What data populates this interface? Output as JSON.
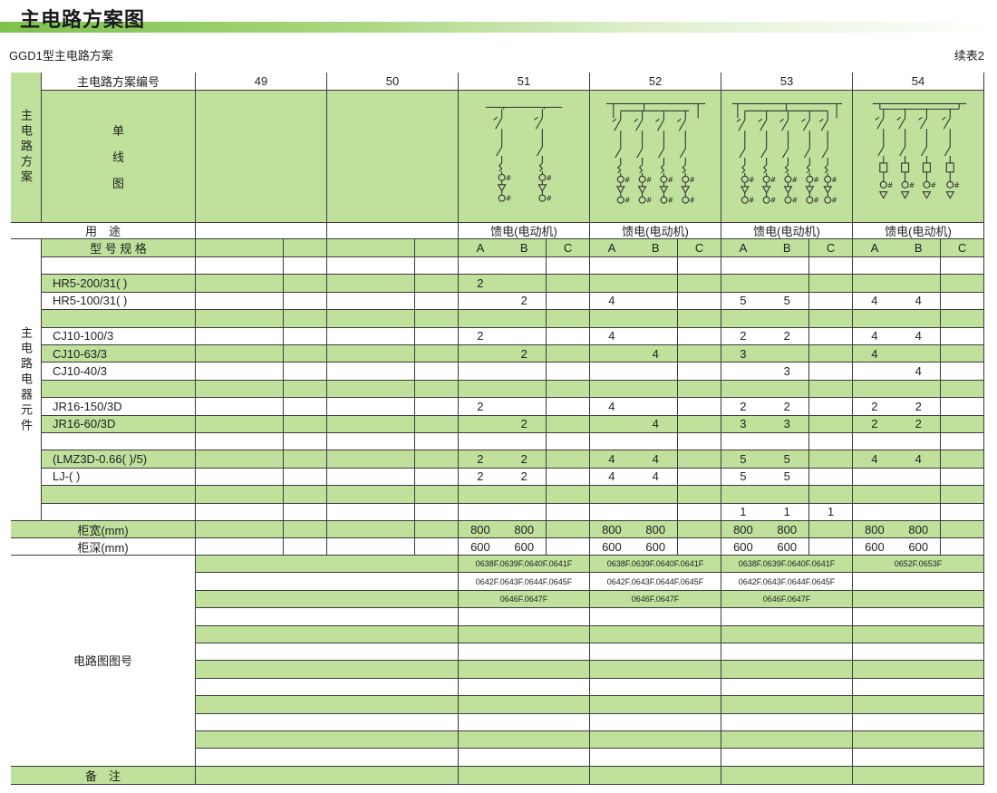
{
  "page": {
    "title": "主电路方案图",
    "subtitle": "GGD1型主电路方案",
    "continued": "续表2"
  },
  "table": {
    "header_scheme_number": "主电路方案编号",
    "left_label_scheme": "主电路方案",
    "single_line_label": [
      "单",
      "线",
      "图"
    ],
    "usage_label": "用　途",
    "model_label": "型 号 规 格",
    "left_label_components": "主电路电器元件",
    "width_label": "柜宽(mm)",
    "depth_label": "柜深(mm)",
    "circuit_no_label": "电路图图号",
    "remarks_label": "备　注",
    "schemes": [
      {
        "no": "49",
        "usage": "",
        "diagram": "none"
      },
      {
        "no": "50",
        "usage": "",
        "diagram": "none"
      },
      {
        "no": "51",
        "usage": "馈电(电动机)",
        "diagram": "two-branch"
      },
      {
        "no": "52",
        "usage": "馈电(电动机)",
        "diagram": "four-branch"
      },
      {
        "no": "53",
        "usage": "馈电(电动机)",
        "diagram": "five-branch"
      },
      {
        "no": "54",
        "usage": "馈电(电动机)",
        "diagram": "four-branch-alt"
      }
    ],
    "sub_columns": [
      "A",
      "B",
      "C"
    ],
    "components": [
      {
        "name": "",
        "values": [
          "",
          "",
          "",
          "",
          "",
          "",
          "",
          "",
          "",
          "",
          "",
          "",
          "",
          "",
          "",
          "",
          "",
          ""
        ]
      },
      {
        "name": "HR5-200/31(  )",
        "values": [
          "",
          "",
          "",
          "",
          "",
          "",
          "2",
          "",
          "",
          "",
          "",
          "",
          "",
          "",
          "",
          "",
          "",
          ""
        ]
      },
      {
        "name": "HR5-100/31(  )",
        "values": [
          "",
          "",
          "",
          "",
          "",
          "",
          "",
          "2",
          "",
          "4",
          "",
          "",
          "5",
          "5",
          "",
          "4",
          "4",
          ""
        ]
      },
      {
        "name": "",
        "values": [
          "",
          "",
          "",
          "",
          "",
          "",
          "",
          "",
          "",
          "",
          "",
          "",
          "",
          "",
          "",
          "",
          "",
          ""
        ]
      },
      {
        "name": "CJ10-100/3",
        "values": [
          "",
          "",
          "",
          "",
          "",
          "",
          "2",
          "",
          "",
          "4",
          "",
          "",
          "2",
          "2",
          "",
          "4",
          "4",
          ""
        ]
      },
      {
        "name": "CJ10-63/3",
        "values": [
          "",
          "",
          "",
          "",
          "",
          "",
          "",
          "2",
          "",
          "",
          "4",
          "",
          "3",
          "",
          "",
          "4",
          "",
          ""
        ]
      },
      {
        "name": "CJ10-40/3",
        "values": [
          "",
          "",
          "",
          "",
          "",
          "",
          "",
          "",
          "",
          "",
          "",
          "",
          "",
          "3",
          "",
          "",
          "4",
          ""
        ]
      },
      {
        "name": "",
        "values": [
          "",
          "",
          "",
          "",
          "",
          "",
          "",
          "",
          "",
          "",
          "",
          "",
          "",
          "",
          "",
          "",
          "",
          ""
        ]
      },
      {
        "name": "JR16-150/3D",
        "values": [
          "",
          "",
          "",
          "",
          "",
          "",
          "2",
          "",
          "",
          "4",
          "",
          "",
          "2",
          "2",
          "",
          "2",
          "2",
          ""
        ]
      },
      {
        "name": "JR16-60/3D",
        "values": [
          "",
          "",
          "",
          "",
          "",
          "",
          "",
          "2",
          "",
          "",
          "4",
          "",
          "3",
          "3",
          "",
          "2",
          "2",
          ""
        ]
      },
      {
        "name": "",
        "values": [
          "",
          "",
          "",
          "",
          "",
          "",
          "",
          "",
          "",
          "",
          "",
          "",
          "",
          "",
          "",
          "",
          "",
          ""
        ]
      },
      {
        "name": "(LMZ3D-0.66(  )/5)",
        "values": [
          "",
          "",
          "",
          "",
          "",
          "",
          "2",
          "2",
          "",
          "4",
          "4",
          "",
          "5",
          "5",
          "",
          "4",
          "4",
          ""
        ]
      },
      {
        "name": "LJ-(  )",
        "values": [
          "",
          "",
          "",
          "",
          "",
          "",
          "2",
          "2",
          "",
          "4",
          "4",
          "",
          "5",
          "5",
          "",
          "",
          "",
          ""
        ]
      },
      {
        "name": "",
        "values": [
          "",
          "",
          "",
          "",
          "",
          "",
          "",
          "",
          "",
          "",
          "",
          "",
          "",
          "",
          "",
          "",
          "",
          ""
        ]
      },
      {
        "name": "",
        "values": [
          "",
          "",
          "",
          "",
          "",
          "",
          "",
          "",
          "",
          "",
          "",
          "",
          "1",
          "1",
          "1",
          "",
          "",
          ""
        ]
      }
    ],
    "cabinet_width": [
      "",
      "",
      "",
      "",
      "",
      "",
      "800",
      "800",
      "",
      "800",
      "800",
      "",
      "800",
      "800",
      "",
      "800",
      "800",
      ""
    ],
    "cabinet_depth": [
      "",
      "",
      "",
      "",
      "",
      "",
      "600",
      "600",
      "",
      "600",
      "600",
      "",
      "600",
      "600",
      "",
      "600",
      "600",
      ""
    ],
    "circuit_numbers": [
      [
        "",
        "",
        "0638F.0639F.0640F.0641F",
        "0638F.0639F.0640F.0641F",
        "0638F.0639F.0640F.0641F",
        "0652F.0653F"
      ],
      [
        "",
        "",
        "0642F.0643F.0644F.0645F",
        "0642F.0643F.0644F.0645F",
        "0642F.0643F.0644F.0645F",
        ""
      ],
      [
        "",
        "",
        "0646F.0647F",
        "0646F.0647F",
        "0646F.0647F",
        ""
      ],
      [
        "",
        "",
        "",
        "",
        "",
        ""
      ],
      [
        "",
        "",
        "",
        "",
        "",
        ""
      ],
      [
        "",
        "",
        "",
        "",
        "",
        ""
      ],
      [
        "",
        "",
        "",
        "",
        "",
        ""
      ],
      [
        "",
        "",
        "",
        "",
        "",
        ""
      ],
      [
        "",
        "",
        "",
        "",
        "",
        ""
      ],
      [
        "",
        "",
        "",
        "",
        "",
        ""
      ],
      [
        "",
        "",
        "",
        "",
        "",
        ""
      ],
      [
        "",
        "",
        "",
        "",
        "",
        ""
      ]
    ]
  },
  "colors": {
    "accent_green": "#bfe19c",
    "title_bar_green": "#7cc24a",
    "grid_line": "#3c3c3c"
  },
  "diagram_symbols": {
    "ct_mark": "#"
  }
}
